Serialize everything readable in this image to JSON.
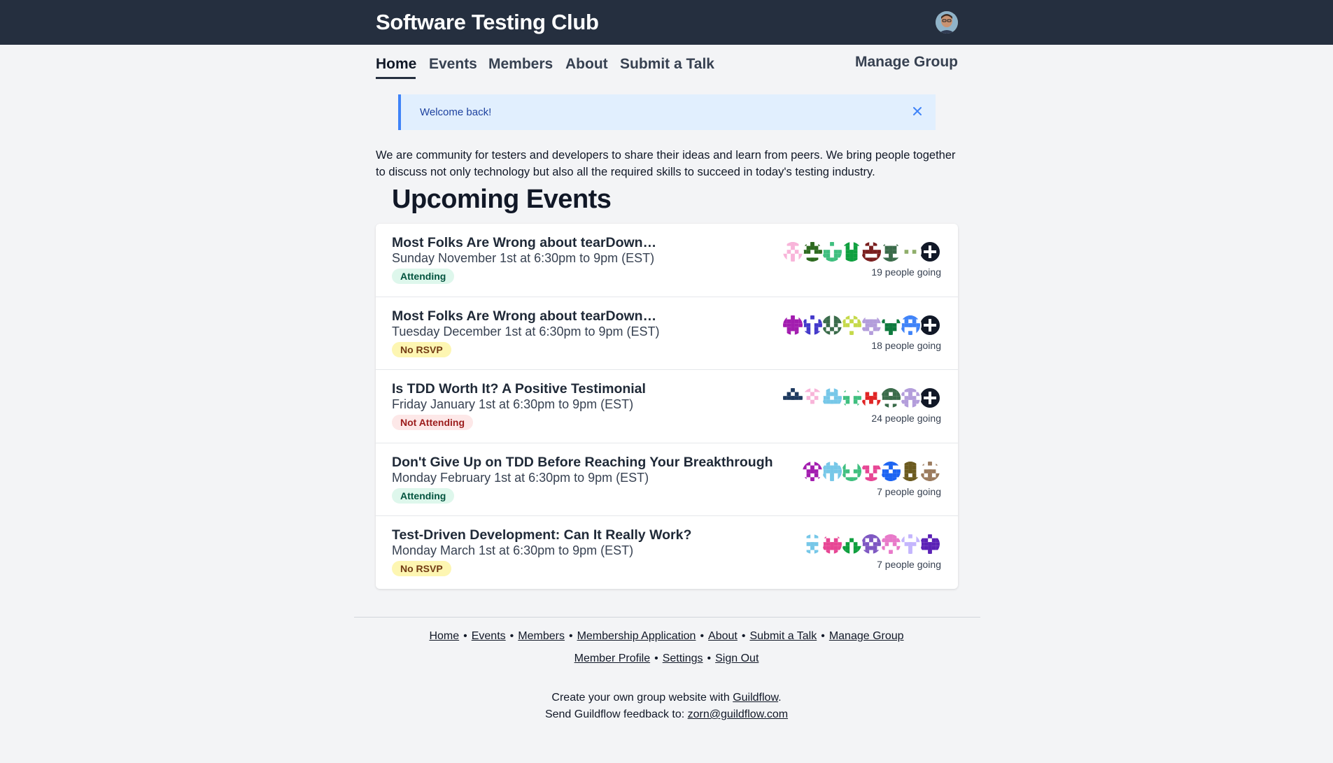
{
  "header": {
    "brand": "Software Testing Club"
  },
  "nav": {
    "items": [
      {
        "label": "Home"
      },
      {
        "label": "Events"
      },
      {
        "label": "Members"
      },
      {
        "label": "About"
      },
      {
        "label": "Submit a Talk"
      }
    ],
    "manage": "Manage Group"
  },
  "alert": {
    "text": "Welcome back!"
  },
  "intro": "We are community for testers and developers to share their ideas and learn from peers. We bring people together to discuss not only technology but also all the required skills to succeed in today's testing industry.",
  "section_title": "Upcoming Events",
  "events": [
    {
      "title": "Most Folks Are Wrong about tearDown…",
      "date": "Sunday November 1st at 6:30pm to 9pm (EST)",
      "status": "Attending",
      "going": "19 people going"
    },
    {
      "title": "Most Folks Are Wrong about tearDown…",
      "date": "Tuesday December 1st at 6:30pm to 9pm (EST)",
      "status": "No RSVP",
      "going": "18 people going"
    },
    {
      "title": "Is TDD Worth It? A Positive Testimonial",
      "date": "Friday January 1st at 6:30pm to 9pm (EST)",
      "status": "Not Attending",
      "going": "24 people going"
    },
    {
      "title": "Don't Give Up on TDD Before Reaching Your Breakthrough",
      "date": "Monday February 1st at 6:30pm to 9pm (EST)",
      "status": "Attending",
      "going": "7 people going"
    },
    {
      "title": "Test-Driven Development: Can It Really Work?",
      "date": "Monday March 1st at 6:30pm to 9pm (EST)",
      "status": "No RSVP",
      "going": "7 people going"
    }
  ],
  "avatar_colors": [
    [
      "#f8b4d9",
      "#2d6a1f",
      "#3fbf7f",
      "#0e9f3e",
      "#7a1f1f",
      "#3a6b4a",
      "#8fae6a"
    ],
    [
      "#a21caf",
      "#4338ca",
      "#3a6b4a",
      "#c5d94a",
      "#b39ddb",
      "#0e7a3e",
      "#3f83f8"
    ],
    [
      "#1e3a5f",
      "#f8b4d9",
      "#76c7e8",
      "#3fbf7f",
      "#e02424",
      "#3a6b4a",
      "#b39ddb"
    ],
    [
      "#a21caf",
      "#76c7e8",
      "#3fbf7f",
      "#e74694",
      "#1c64f2",
      "#6b5a1f",
      "#9b7b5e"
    ],
    [
      "#76c7e8",
      "#e74694",
      "#0e9f3e",
      "#7e57c2",
      "#e879c9",
      "#c4b5fd",
      "#5b21b6"
    ]
  ],
  "footer": {
    "links_row1": [
      "Home",
      "Events",
      "Members",
      "Membership Application",
      "About",
      "Submit a Talk",
      "Manage Group"
    ],
    "links_row2": [
      "Member Profile",
      "Settings",
      "Sign Out"
    ],
    "credit_prefix": "Create your own group website with ",
    "credit_link": "Guildflow",
    "credit_suffix": ".",
    "feedback_prefix": "Send Guildflow feedback to: ",
    "feedback_email": "zorn@guildflow.com"
  }
}
